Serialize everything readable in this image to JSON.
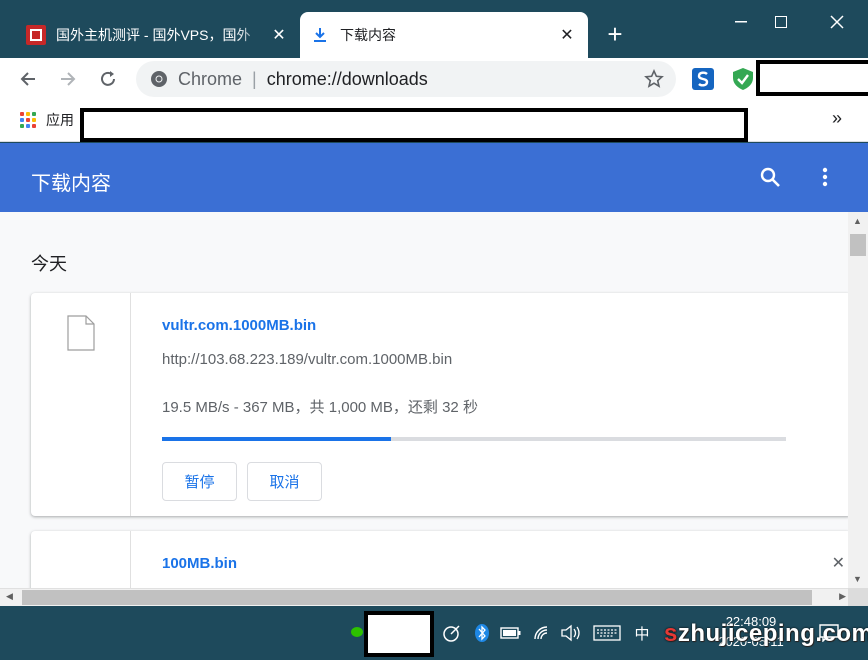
{
  "tabs": [
    {
      "title": "国外主机测评 - 国外VPS，国外",
      "favicon": "site-logo-icon",
      "active": false
    },
    {
      "title": "下载内容",
      "favicon": "download-icon",
      "active": true
    }
  ],
  "toolbar": {
    "omnibox_scheme": "Chrome",
    "omnibox_url": "chrome://downloads"
  },
  "bookmarks": {
    "apps_label": "应用",
    "overflow": "»"
  },
  "page": {
    "title": "下载内容"
  },
  "downloads": {
    "section_label": "今天",
    "items": [
      {
        "filename": "vultr.com.1000MB.bin",
        "url": "http://103.68.223.189/vultr.com.1000MB.bin",
        "status": "19.5 MB/s - 367 MB，共 1,000 MB，还剩 32 秒",
        "progress": 0.367,
        "pause_label": "暂停",
        "cancel_label": "取消"
      },
      {
        "filename": "100MB.bin"
      }
    ]
  },
  "taskbar": {
    "ime": "中",
    "time": "22:48:09",
    "date": "2020-05-11",
    "watermark": "szhujiceping.com"
  },
  "colors": {
    "accent": "#1a73e8",
    "header": "#3b6fd4",
    "frame": "#1e4a5c"
  }
}
